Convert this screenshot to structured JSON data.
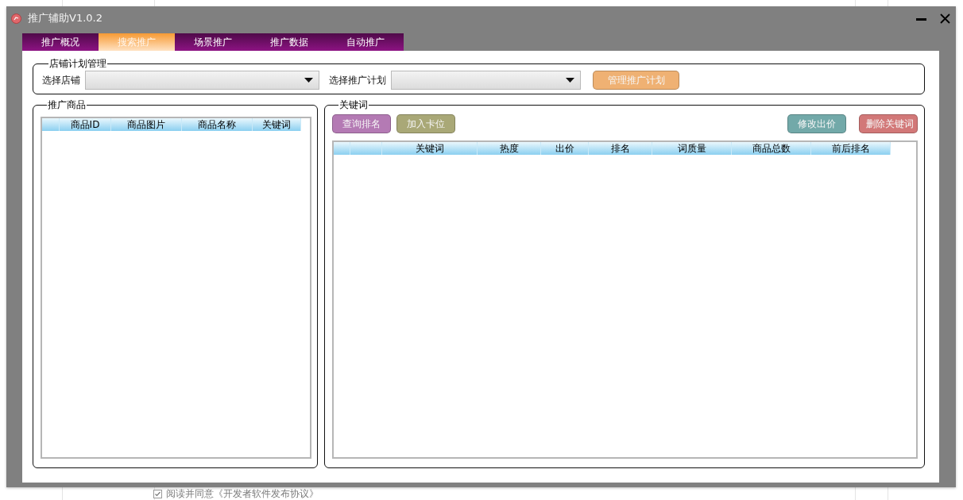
{
  "window": {
    "title": "推广辅助V1.0.2"
  },
  "tabs": [
    {
      "label": "推广概况",
      "selected": false
    },
    {
      "label": "搜索推广",
      "selected": true
    },
    {
      "label": "场景推广",
      "selected": false
    },
    {
      "label": "推广数据",
      "selected": false
    },
    {
      "label": "自动推广",
      "selected": false
    }
  ],
  "store_plan": {
    "title": "店铺计划管理",
    "fields": [
      {
        "label": "选择店铺"
      },
      {
        "label": "选择推广计划"
      }
    ],
    "manage_button": {
      "label": "管理推广计划",
      "color": "#efb173"
    }
  },
  "products": {
    "title": "推广商品",
    "table": {
      "columns": [
        "商品ID",
        "商品图片",
        "商品名称",
        "关键词"
      ]
    }
  },
  "keywords": {
    "title": "关键词",
    "left_buttons": [
      {
        "label": "查询排名",
        "color": "#b47ab4"
      },
      {
        "label": "加入卡位",
        "color": "#a9a877"
      }
    ],
    "right_buttons": [
      {
        "label": "修改出价",
        "color": "#72a9a9"
      },
      {
        "label": "删除关键词",
        "color": "#d27878"
      }
    ],
    "table": {
      "columns": [
        "关键词",
        "热度",
        "出价",
        "排名",
        "词质量",
        "商品总数",
        "前后排名"
      ]
    }
  },
  "background_page": {
    "agreement": "阅读并同意《开发者软件发布协议》"
  }
}
